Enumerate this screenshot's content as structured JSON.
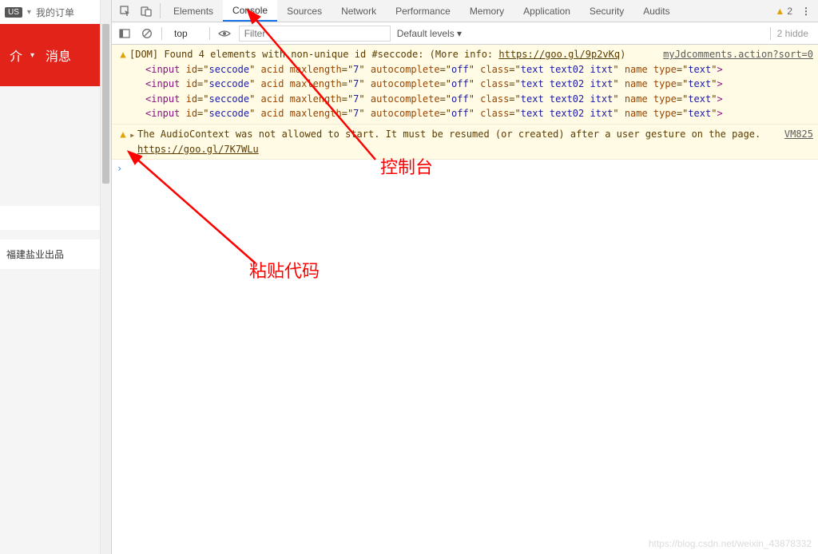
{
  "left": {
    "badge": "US",
    "my_orders": "我的订单",
    "nav_item1": "介",
    "nav_item2": "消息",
    "footer_text": "福建盐业出品"
  },
  "devtools": {
    "tabs": {
      "elements": "Elements",
      "console": "Console",
      "sources": "Sources",
      "network": "Network",
      "performance": "Performance",
      "memory": "Memory",
      "application": "Application",
      "security": "Security",
      "audits": "Audits"
    },
    "warn_count": "2",
    "toolbar": {
      "context": "top",
      "filter_placeholder": "Filter",
      "levels": "Default levels ▾",
      "hidden": "2 hidde"
    }
  },
  "console": {
    "msg1": {
      "prefix": "[DOM] Found 4 elements with non-unique id #seccode: (More info: ",
      "link": "https://goo.gl/9p2vKq",
      "suffix": ")",
      "source": "myJdcomments.action?sort=0",
      "rows": [
        {
          "tag": "input",
          "id": "seccode",
          "attrs": "acid maxlength",
          "ml": "7",
          "ac": "autocomplete",
          "acv": "off",
          "cls": "class",
          "clsv": "text text02 itxt",
          "nm": "name type",
          "tv": "text"
        },
        {
          "tag": "input",
          "id": "seccode",
          "attrs": "acid maxlength",
          "ml": "7",
          "ac": "autocomplete",
          "acv": "off",
          "cls": "class",
          "clsv": "text text02 itxt",
          "nm": "name type",
          "tv": "text"
        },
        {
          "tag": "input",
          "id": "seccode",
          "attrs": "acid maxlength",
          "ml": "7",
          "ac": "autocomplete",
          "acv": "off",
          "cls": "class",
          "clsv": "text text02 itxt",
          "nm": "name type",
          "tv": "text"
        },
        {
          "tag": "input",
          "id": "seccode",
          "attrs": "acid maxlength",
          "ml": "7",
          "ac": "autocomplete",
          "acv": "off",
          "cls": "class",
          "clsv": "text text02 itxt",
          "nm": "name type",
          "tv": "text"
        }
      ]
    },
    "msg2": {
      "text": "The AudioContext was not allowed to start. It must be resumed (or created) after a user gesture on the page. ",
      "link": "https://goo.gl/7K7WLu",
      "source": "VM825"
    }
  },
  "annotations": {
    "label_console": "控制台",
    "label_paste": "粘贴代码"
  },
  "watermark": "https://blog.csdn.net/weixin_43878332"
}
